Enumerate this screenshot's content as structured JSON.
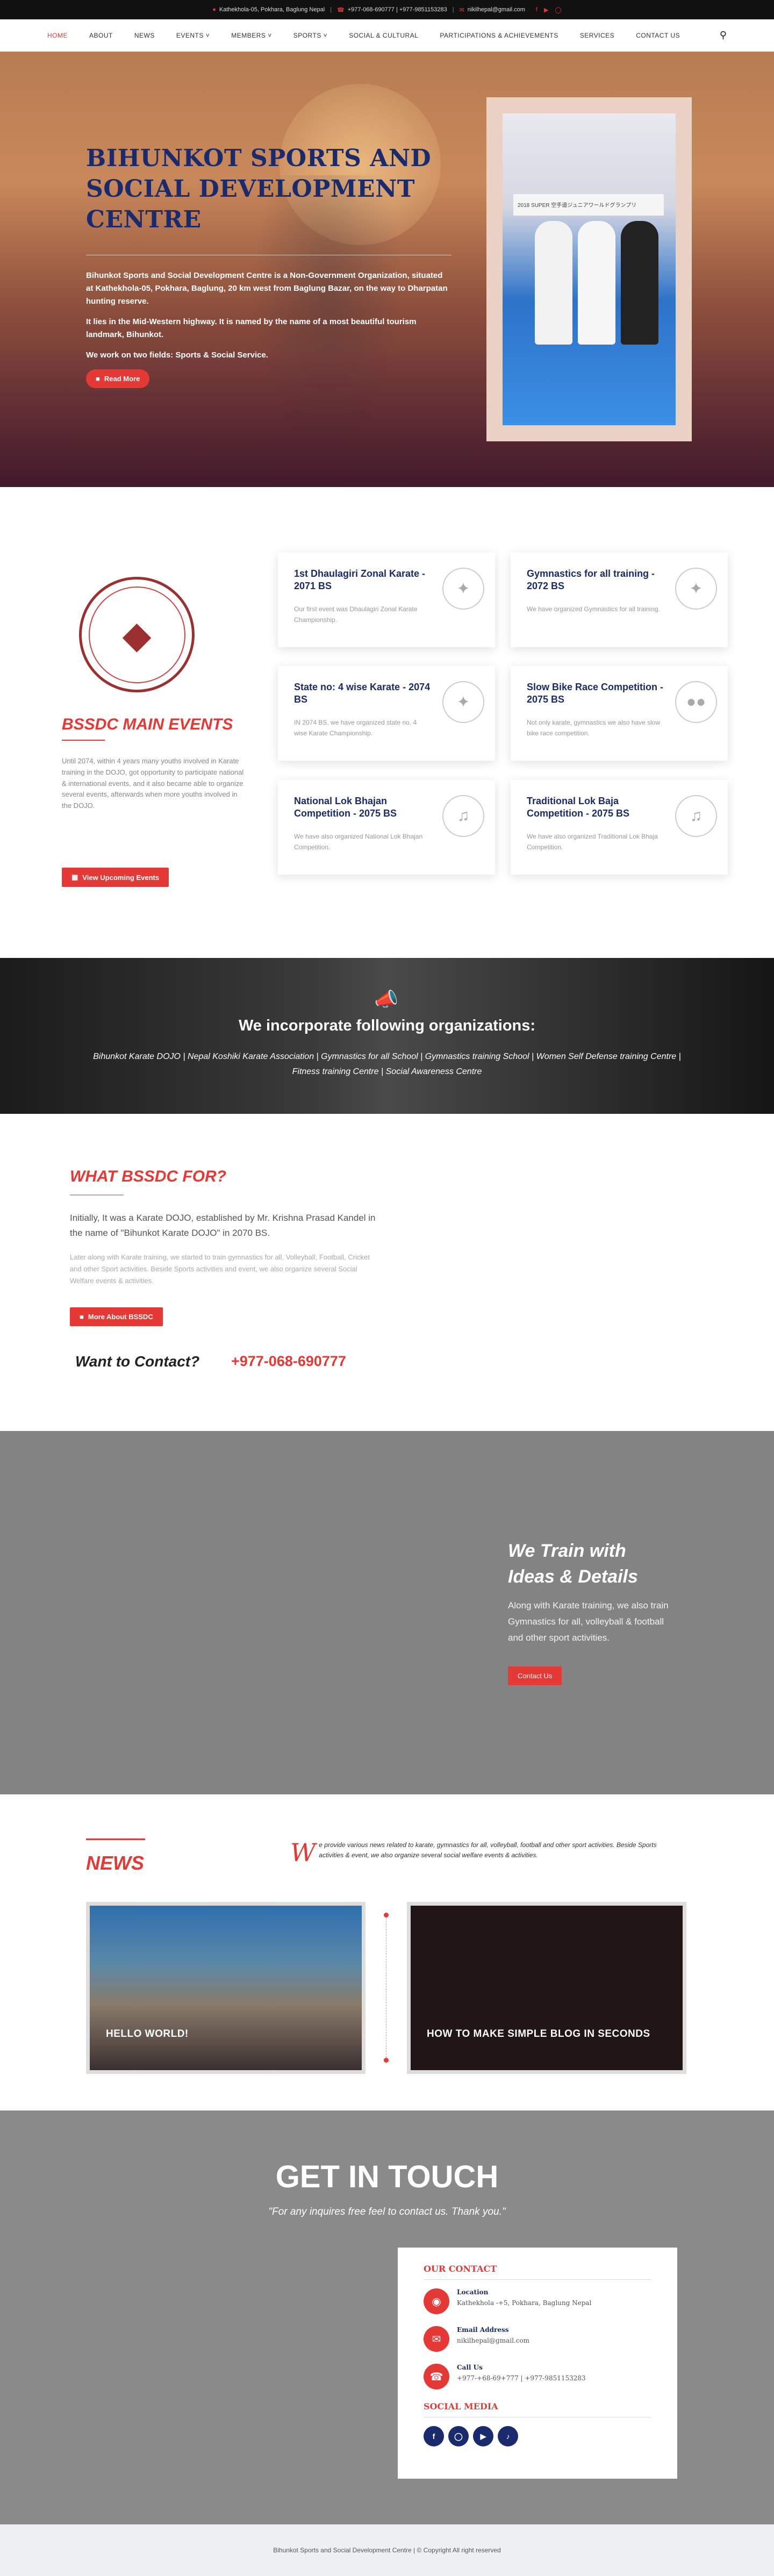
{
  "topbar": {
    "address": "Kathekhola-05, Pokhara, Baglung Nepal",
    "phones": "+977-068-690777 | +977-9851153283",
    "email": "nikilhepal@gmail.com",
    "social_icons": [
      "facebook-icon",
      "youtube-icon",
      "instagram-icon"
    ]
  },
  "nav": {
    "items": [
      "HOME",
      "ABOUT",
      "NEWS",
      "EVENTS ˅",
      "MEMBERS ˅",
      "SPORTS ˅",
      "SOCIAL & CULTURAL",
      "PARTICIPATIONS & ACHIEVEMENTS",
      "SERVICES",
      "CONTACT US"
    ],
    "active": "HOME"
  },
  "hero": {
    "title": "BIHUNKOT SPORTS AND SOCIAL DEVELOPMENT CENTRE",
    "p1": "Bihunkot Sports and Social Development Centre is a Non-Government Organization, situated at Kathekhola-05, Pokhara, Baglung, 20 km west from Baglung Bazar, on the way to Dharpatan hunting reserve.",
    "p2": "It lies in the Mid-Western highway. It is named by the name of a most beautiful tourism landmark, Bihunkot.",
    "p3": "We work on two fields: Sports & Social Service.",
    "button": "Read More",
    "photo_banner": "2018 SUPER 空手道ジュニアワールドグランプリ"
  },
  "events": {
    "heading": "BSSDC MAIN EVENTS",
    "description": "Until 2074, within 4 years many youths involved in Karate training in the DOJO, got opportunity to participate national & international events, and it also became able to organize several events, afterwards when more youths involved in the DOJO.",
    "button": "View Upcoming Events",
    "cards": [
      {
        "title": "1st Dhaulagiri Zonal Karate - 2071 BS",
        "text": "Our first event was Dhaulagiri Zonal Karate Championship."
      },
      {
        "title": "Gymnastics for all training - 2072 BS",
        "text": "We have organized Gymnastics for all training."
      },
      {
        "title": "State no: 4 wise Karate - 2074 BS",
        "text": "IN 2074 BS, we have organized state no. 4 wise Karate Championship."
      },
      {
        "title": "Slow Bike Race Competition - 2075 BS",
        "text": "Not only karate, gymnastics we also have slow bike race competition."
      },
      {
        "title": "National Lok Bhajan Competition - 2075 BS",
        "text": "We have also organized National Lok Bhajan Competition."
      },
      {
        "title": "Traditional Lok Baja Competition - 2075 BS",
        "text": "We have also organized Traditional Lok Bhaja Competition."
      }
    ]
  },
  "orgs": {
    "heading": "We incorporate following organizations:",
    "list": "Bihunkot Karate DOJO | Nepal Koshiki Karate Association | Gymnastics for all School | Gymnastics training School | Women Self Defense training Centre | Fitness training Centre | Social Awareness Centre"
  },
  "about": {
    "heading": "WHAT BSSDC FOR?",
    "lead": "Initially, It was a Karate DOJO, established by Mr. Krishna Prasad Kandel in the name of \"Bihunkot Karate DOJO\" in 2070 BS.",
    "small": "Later along with Karate training, we started to train gymnastics for all, Volleyball, Football, Cricket and other Sport activities. Beside Sports activities and event, we also organize several Social Welfare events & activities.",
    "button": "More About BSSDC",
    "want": "Want to Contact?",
    "phone": "+977-068-690777"
  },
  "train": {
    "heading": "We Train with Ideas & Details",
    "text": "Along with Karate training, we also train Gymnastics for all, volleyball & football and other sport activities.",
    "button": "Contact Us"
  },
  "news": {
    "heading": "NEWS",
    "intro_cap": "W",
    "intro": "e provide various news related to karate, gymnastics for all, volleyball, football and other sport activities. Beside Sports activities & event, we also organize several social welfare events & activities.",
    "posts": [
      "HELLO WORLD!",
      "HOW TO MAKE SIMPLE BLOG IN SECONDS"
    ]
  },
  "touch": {
    "heading": "GET IN TOUCH",
    "sub": "\"For any inquires free feel to contact us. Thank you.\"",
    "box_heading": "OUR CONTACT",
    "location_label": "Location",
    "location": "Kathekhola -+5, Pokhara, Baglung Nepal",
    "email_label": "Email Address",
    "email": "nikilhepal@gmail.com",
    "call_label": "Call Us",
    "call": "+977-+68-69+777 | +977-9851153283",
    "social_heading": "SOCIAL MEDIA",
    "social_icons": [
      "facebook-icon",
      "instagram-icon",
      "youtube-icon",
      "tiktok-icon"
    ]
  },
  "footer": {
    "text": "Bihunkot Sports and Social Development Centre | © Copyright All right reserved"
  },
  "colors": {
    "accent": "#e53935",
    "navy": "#1a2b6d"
  }
}
